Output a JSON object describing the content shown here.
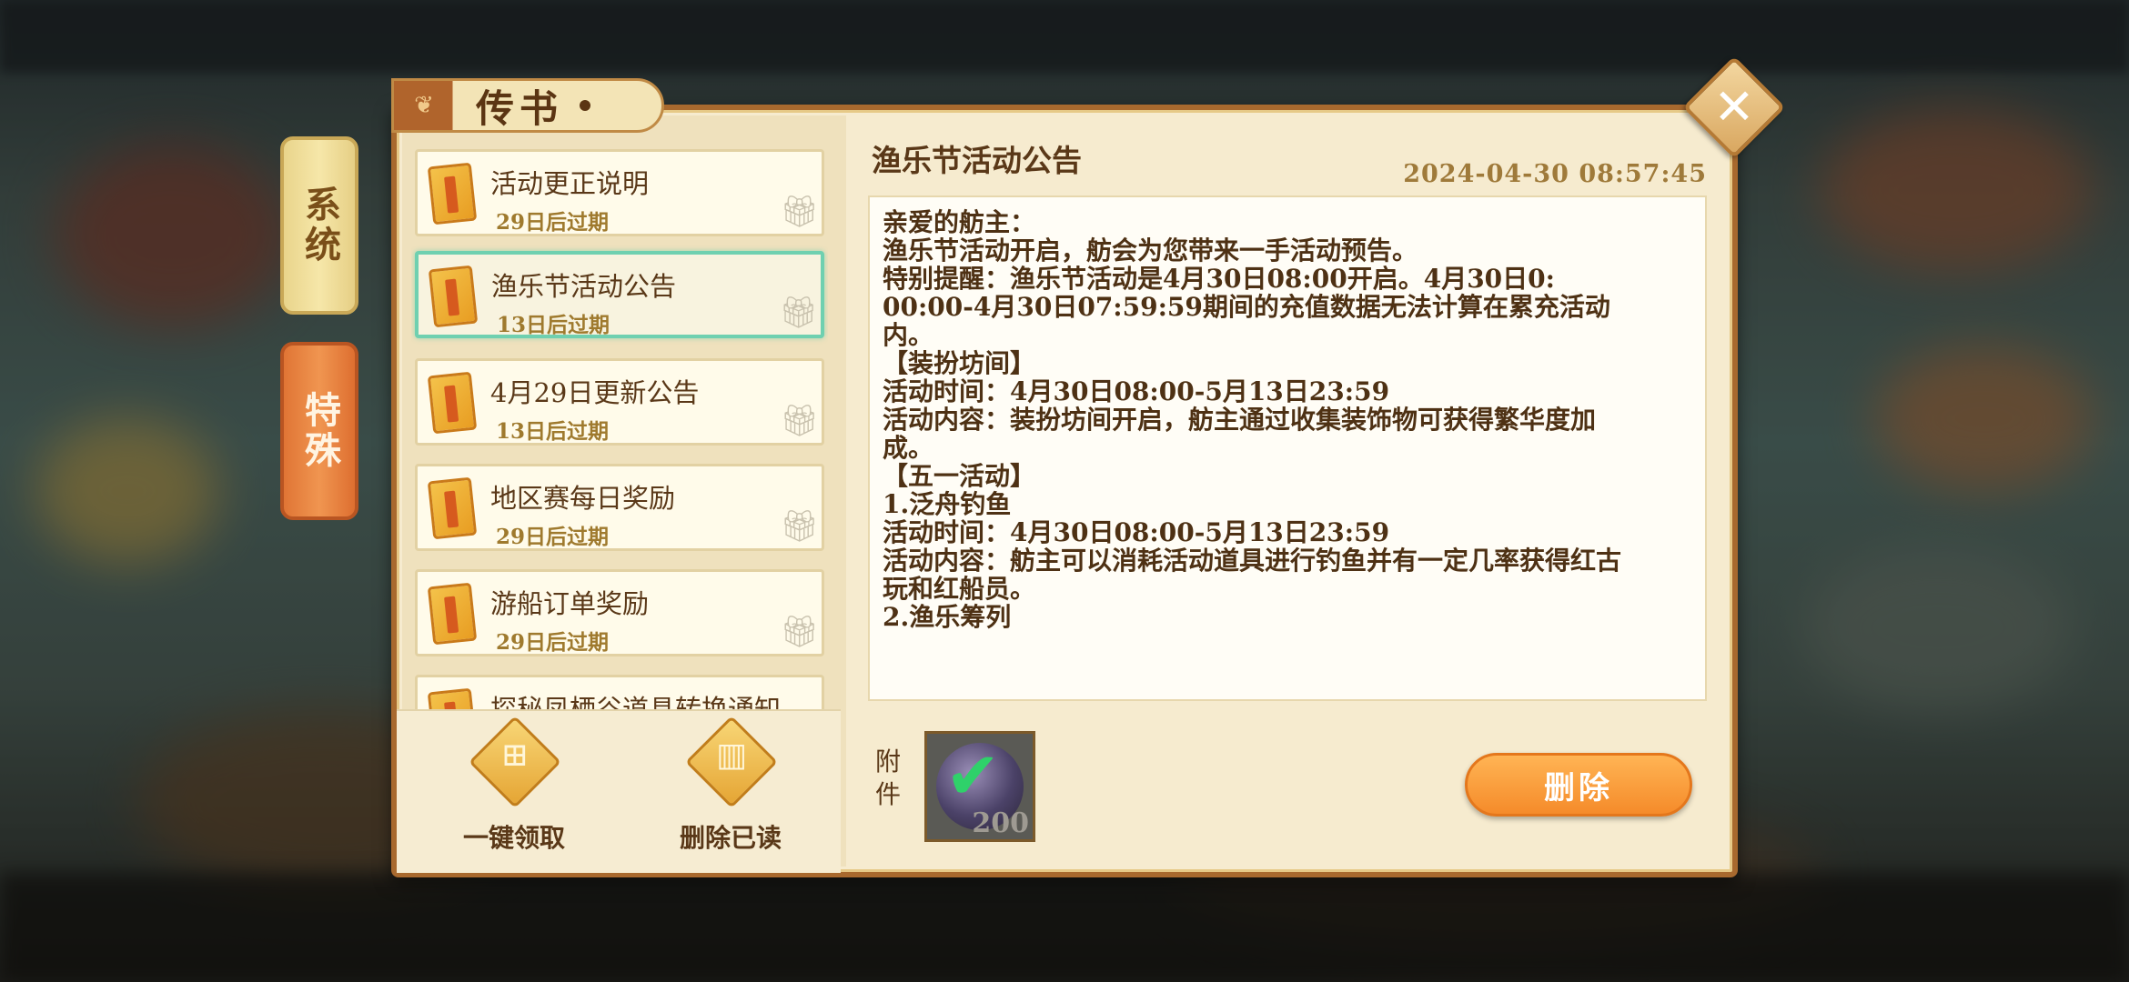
{
  "window": {
    "title": "传书"
  },
  "side_tabs": {
    "system": "系统",
    "special": "特殊"
  },
  "mail_list": [
    {
      "title": "活动更正说明",
      "expire": "29日后过期",
      "selected": false
    },
    {
      "title": "渔乐节活动公告",
      "expire": "13日后过期",
      "selected": true
    },
    {
      "title": "4月29日更新公告",
      "expire": "13日后过期",
      "selected": false
    },
    {
      "title": "地区赛每日奖励",
      "expire": "29日后过期",
      "selected": false
    },
    {
      "title": "游船订单奖励",
      "expire": "29日后过期",
      "selected": false
    },
    {
      "title": "探秘凤栖谷道具转换通知",
      "expire": "",
      "selected": false
    }
  ],
  "bottom_actions": {
    "claim_all": "一键领取",
    "delete_read": "删除已读"
  },
  "detail": {
    "title": "渔乐节活动公告",
    "date": "2024-04-30  08:57:45",
    "lines": [
      "亲爱的舫主：",
      "渔乐节活动开启，舫会为您带来一手活动预告。",
      "特别提醒：渔乐节活动是4月30日08:00开启。4月30日0:",
      "00:00-4月30日07:59:59期间的充值数据无法计算在累充活动",
      "内。",
      "",
      "【装扮坊间】",
      "活动时间：4月30日08:00-5月13日23:59",
      "活动内容：装扮坊间开启，舫主通过收集装饰物可获得繁华度加",
      "成。",
      "",
      "【五一活动】",
      "1.泛舟钓鱼",
      "活动时间：4月30日08:00-5月13日23:59",
      "活动内容：舫主可以消耗活动道具进行钓鱼并有一定几率获得红古",
      "玩和红船员。",
      "",
      "2.渔乐筹列"
    ],
    "attachment_label": "附件",
    "attachment_qty": "200",
    "delete_label": "删除"
  },
  "icons": {
    "close": "close-icon",
    "mail": "scroll-icon",
    "gift": "gift-icon",
    "claim": "gift-diamond-icon",
    "trash": "trash-diamond-icon",
    "attachment": "check-orb-icon"
  },
  "colors": {
    "accent_selected": "#6fd0b0",
    "delete_button": "#f58b2a",
    "panel_bg": "#f6ebcf"
  }
}
